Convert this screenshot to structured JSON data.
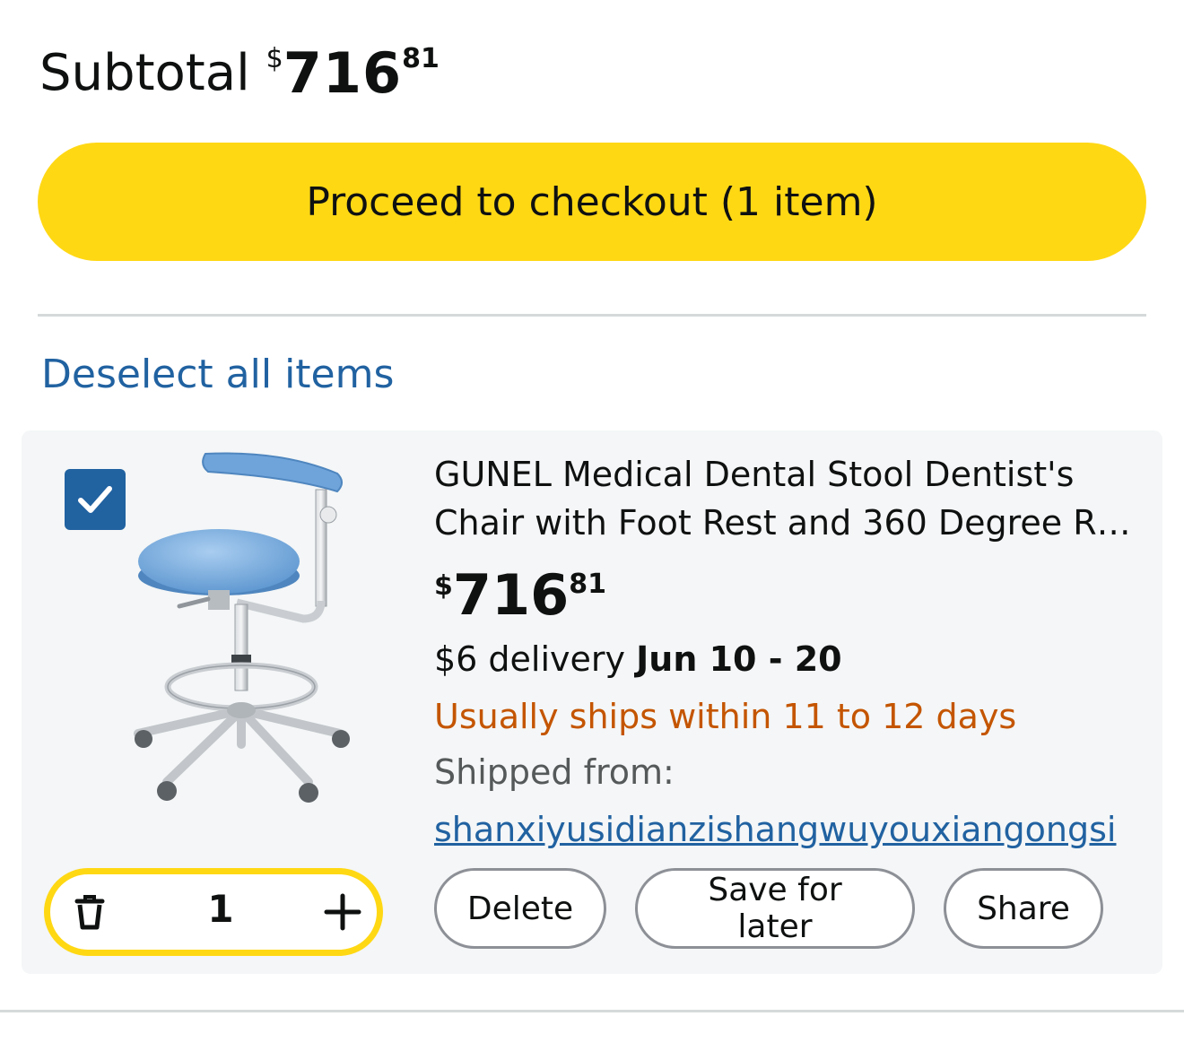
{
  "subtotal": {
    "label": "Subtotal",
    "currency": "$",
    "whole": "716",
    "fraction": "81"
  },
  "checkout": {
    "label": "Proceed to checkout (1 item)",
    "color": "#ffd814"
  },
  "deselect_label": "Deselect all items",
  "item": {
    "selected": true,
    "image_icon": "dental-stool-image",
    "title": "GUNEL Medical Dental Stool Dentist's Chair with Foot Rest and 360 Degree R…",
    "price": {
      "currency": "$",
      "whole": "716",
      "fraction": "81"
    },
    "delivery": {
      "prefix": "$6 delivery",
      "dates": "Jun 10 - 20"
    },
    "ships_note": "Usually ships within 11 to 12 days",
    "shipped_from_label": "Shipped from:",
    "seller": "shanxiyusidianzishangwuyouxiangongsi",
    "quantity": "1",
    "actions": {
      "delete": "Delete",
      "save": "Save for later",
      "share": "Share"
    }
  },
  "colors": {
    "link": "#2162a1",
    "warning": "#c45500",
    "accent": "#ffd814"
  }
}
